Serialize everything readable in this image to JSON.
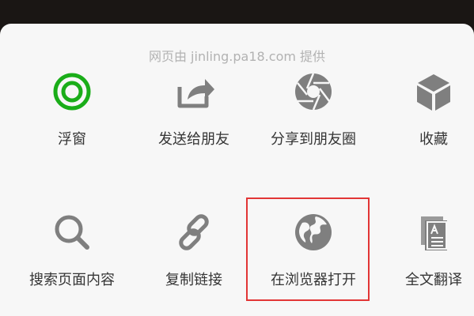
{
  "menu": {
    "source_text": "网页由 jinling.pa18.com 提供",
    "row1": [
      {
        "label": "浮窗",
        "icon": "floating-window-icon"
      },
      {
        "label": "发送给朋友",
        "icon": "share-arrow-icon"
      },
      {
        "label": "分享到朋友圈",
        "icon": "moments-aperture-icon"
      },
      {
        "label": "收藏",
        "icon": "favorite-cube-icon"
      }
    ],
    "row2": [
      {
        "label": "搜索页面内容",
        "icon": "search-icon"
      },
      {
        "label": "复制链接",
        "icon": "link-icon"
      },
      {
        "label": "在浏览器打开",
        "icon": "globe-icon"
      },
      {
        "label": "全文翻译",
        "icon": "translate-document-icon"
      }
    ]
  },
  "colors": {
    "accent_green": "#1aad19",
    "icon_gray": "#7f7f7f",
    "highlight_red": "#e23535"
  }
}
